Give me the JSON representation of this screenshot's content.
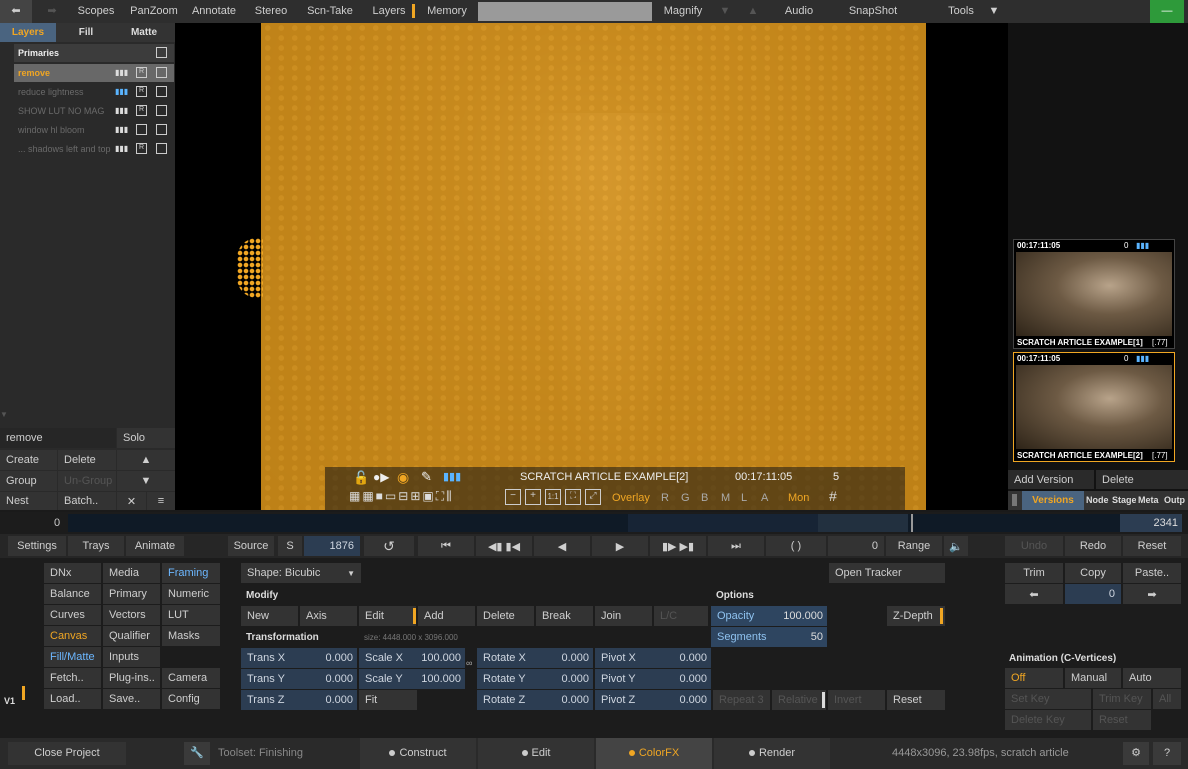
{
  "topbar": {
    "scopes": "Scopes",
    "panzoom": "PanZoom",
    "annotate": "Annotate",
    "stereo": "Stereo",
    "scntake": "Scn-Take",
    "layers": "Layers",
    "memory": "Memory",
    "magnify": "Magnify",
    "audio": "Audio",
    "snapshot": "SnapShot",
    "tools": "Tools"
  },
  "layers_panel": {
    "tabs": [
      "Layers",
      "Fill",
      "Matte"
    ],
    "header": "Primaries",
    "items": [
      "remove",
      "reduce lightness",
      "SHOW LUT NO MAG",
      "window hl bloom",
      "... shadows left and top"
    ],
    "name_value": "remove",
    "solo": "Solo",
    "create": "Create",
    "delete": "Delete",
    "group": "Group",
    "ungroup": "Un-Group",
    "nest": "Nest",
    "batch": "Batch.."
  },
  "viewer": {
    "title": "SCRATCH ARTICLE EXAMPLE[2]",
    "timecode": "00:17:11:05",
    "frame": "5",
    "overlay": "Overlay",
    "channels": [
      "R",
      "G",
      "B",
      "M",
      "L",
      "A"
    ],
    "mon": "Mon"
  },
  "versions": [
    {
      "tc": "00:17:11:05",
      "info": "0",
      "name": "SCRATCH ARTICLE EXAMPLE[1]",
      "rate": "[.77]"
    },
    {
      "tc": "00:17:11:05",
      "info": "0",
      "name": "SCRATCH ARTICLE EXAMPLE[2]",
      "rate": "[.77]"
    }
  ],
  "right_controls": {
    "add_version": "Add Version",
    "delete": "Delete",
    "tabs": [
      "Versions",
      "Node",
      "Stage",
      "Meta",
      "Outp"
    ]
  },
  "timeline": {
    "start": "0",
    "end": "2341"
  },
  "transport": {
    "settings": "Settings",
    "trays": "Trays",
    "animate": "Animate",
    "source": "Source",
    "s": "S",
    "frame": "1876",
    "zero": "0",
    "range": "Range",
    "undo": "Undo",
    "redo": "Redo",
    "reset": "Reset"
  },
  "menu": {
    "col1": [
      "DNx",
      "Balance",
      "Curves",
      "Canvas",
      "Fill/Matte",
      "Fetch..",
      "Load.."
    ],
    "col2": [
      "Media",
      "Primary",
      "Vectors",
      "Qualifier",
      "Inputs",
      "Plug-ins..",
      "Save.."
    ],
    "col3": [
      "Framing",
      "Numeric",
      "LUT",
      "Masks",
      "",
      "Camera",
      "Config"
    ],
    "v1": "V1"
  },
  "shape": {
    "label": "Shape: Bicubic",
    "modify": "Modify",
    "new": "New",
    "axis": "Axis",
    "edit": "Edit",
    "add": "Add",
    "delete": "Delete",
    "break": "Break",
    "join": "Join",
    "lc": "L/C",
    "transformation": "Transformation",
    "size": "size: 4448.000 x 3096.000",
    "trans_x": "Trans X",
    "trans_x_v": "0.000",
    "trans_y": "Trans Y",
    "trans_y_v": "0.000",
    "trans_z": "Trans Z",
    "trans_z_v": "0.000",
    "scale_x": "Scale X",
    "scale_x_v": "100.000",
    "scale_y": "Scale Y",
    "scale_y_v": "100.000",
    "fit": "Fit",
    "rotate_x": "Rotate X",
    "rotate_x_v": "0.000",
    "rotate_y": "Rotate Y",
    "rotate_y_v": "0.000",
    "rotate_z": "Rotate Z",
    "rotate_z_v": "0.000",
    "pivot_x": "Pivot X",
    "pivot_x_v": "0.000",
    "pivot_y": "Pivot Y",
    "pivot_y_v": "0.000",
    "pivot_z": "Pivot Z",
    "pivot_z_v": "0.000",
    "repeat": "Repeat 3",
    "relative": "Relative",
    "invert": "Invert",
    "reset": "Reset"
  },
  "options": {
    "label": "Options",
    "opacity": "Opacity",
    "opacity_v": "100.000",
    "segments": "Segments",
    "segments_v": "50",
    "zdepth": "Z-Depth",
    "open_tracker": "Open Tracker"
  },
  "edit_tools": {
    "trim": "Trim",
    "copy": "Copy",
    "paste": "Paste..",
    "num": "0"
  },
  "animation": {
    "label": "Animation (C-Vertices)",
    "off": "Off",
    "manual": "Manual",
    "auto": "Auto",
    "setkey": "Set Key",
    "trimkey": "Trim Key",
    "all": "All",
    "deletekey": "Delete Key",
    "reset": "Reset"
  },
  "status": {
    "close": "Close Project",
    "toolset": "Toolset: Finishing",
    "construct": "Construct",
    "edit": "Edit",
    "colorfx": "ColorFX",
    "render": "Render",
    "info": "4448x3096, 23.98fps, scratch article",
    "help": "?"
  }
}
